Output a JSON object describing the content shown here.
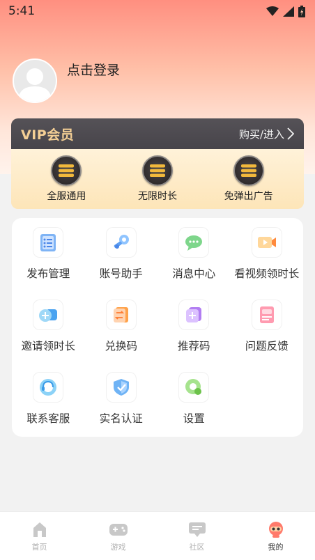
{
  "status_bar": {
    "time": "5:41"
  },
  "profile": {
    "login_prompt": "点击登录"
  },
  "vip": {
    "title": "VIP会员",
    "action": "购买/进入",
    "features": [
      {
        "label": "全服通用",
        "icon": "vip-coin-icon"
      },
      {
        "label": "无限时长",
        "icon": "vip-coin-icon"
      },
      {
        "label": "免弹出广告",
        "icon": "vip-coin-icon"
      }
    ],
    "colors": {
      "title": "#f4cf95",
      "header_bg": "#4e4b50",
      "body_bg": "#fde5b8"
    }
  },
  "menu": {
    "items": [
      {
        "label": "发布管理",
        "icon": "publish-list-icon"
      },
      {
        "label": "账号助手",
        "icon": "account-assistant-icon"
      },
      {
        "label": "消息中心",
        "icon": "message-icon"
      },
      {
        "label": "看视频领时长",
        "icon": "video-icon"
      },
      {
        "label": "邀请领时长",
        "icon": "invite-icon"
      },
      {
        "label": "兑换码",
        "icon": "exchange-code-icon"
      },
      {
        "label": "推荐码",
        "icon": "referral-code-icon"
      },
      {
        "label": "问题反馈",
        "icon": "feedback-icon"
      },
      {
        "label": "联系客服",
        "icon": "customer-service-icon"
      },
      {
        "label": "实名认证",
        "icon": "real-name-verify-icon"
      },
      {
        "label": "设置",
        "icon": "settings-icon"
      }
    ]
  },
  "tabbar": {
    "tabs": [
      {
        "label": "首页",
        "icon": "home-icon",
        "active": false
      },
      {
        "label": "游戏",
        "icon": "gamepad-icon",
        "active": false
      },
      {
        "label": "社区",
        "icon": "community-icon",
        "active": false
      },
      {
        "label": "我的",
        "icon": "profile-mascot-icon",
        "active": true
      }
    ]
  }
}
